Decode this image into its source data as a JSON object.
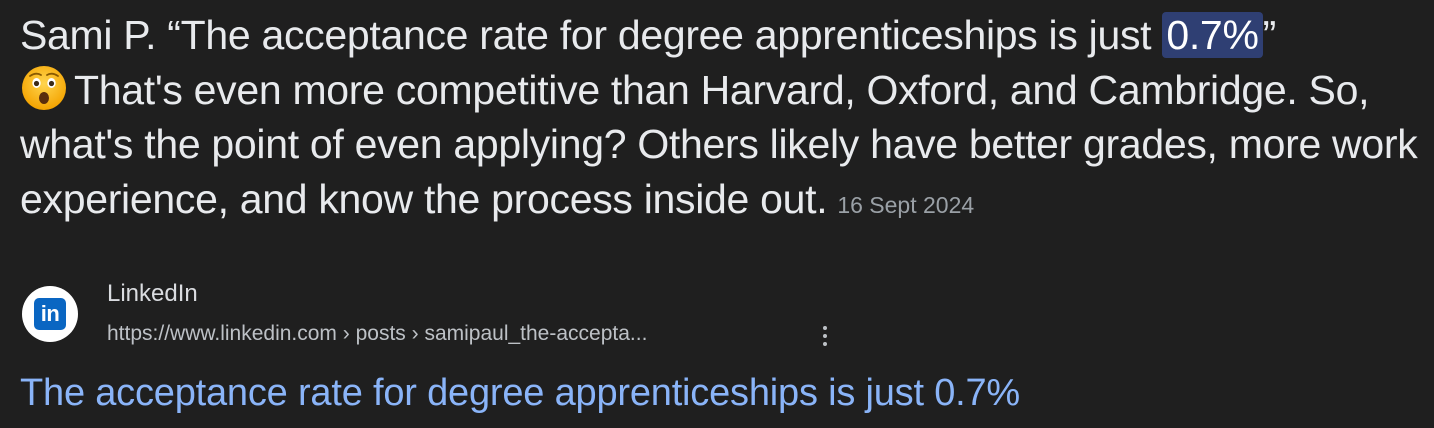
{
  "snippet": {
    "author": "Sami P.",
    "quote_open": "“The acceptance rate for degree apprenticeships is just ",
    "highlight": "0.7%",
    "quote_close": "”",
    "emoji": "😲",
    "body": "That's even more competitive than Harvard, Oxford, and Cambridge. So, what's the point of even applying? Others likely have better grades, more work experience, and know the process inside out.",
    "date": "16 Sept 2024"
  },
  "source": {
    "favicon_icon": "linkedin-icon",
    "favicon_text": "in",
    "site_name": "LinkedIn",
    "url": "https://www.linkedin.com › posts › samipaul_the-accepta...",
    "more_icon": "more-vertical-icon"
  },
  "result": {
    "title": "The acceptance rate for degree apprenticeships is just 0.7%"
  },
  "colors": {
    "background": "#1f1f1f",
    "highlight_bg": "#2f3f73",
    "link": "#8ab4f8",
    "linkedin_blue": "#0a66c2"
  }
}
